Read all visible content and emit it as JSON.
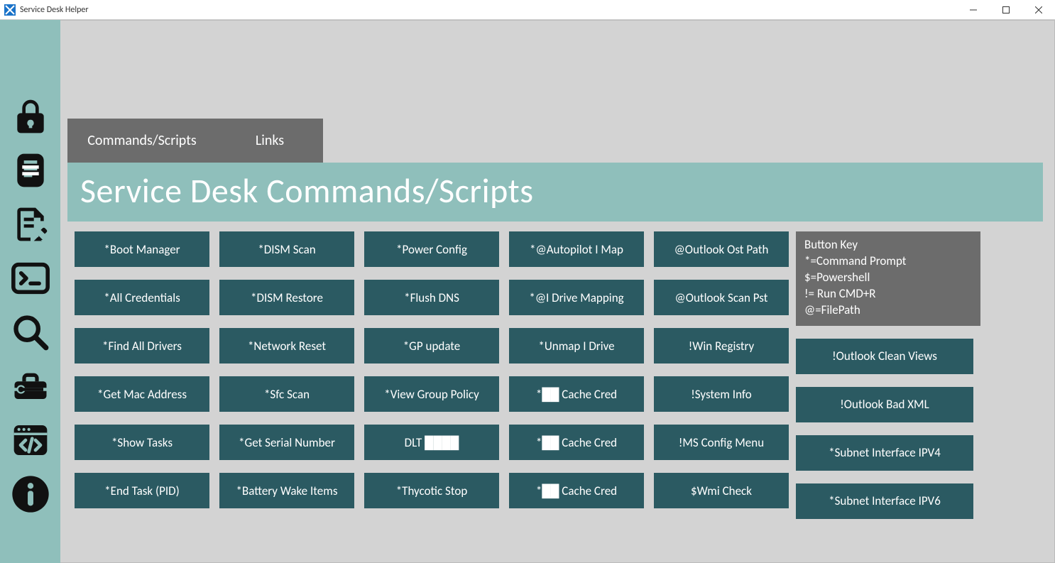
{
  "window": {
    "title": "Service Desk Helper"
  },
  "tabs": {
    "commands": "Commands/Scripts",
    "links": "Links"
  },
  "header": "Service Desk Commands/Scripts",
  "key": {
    "heading": "Button Key",
    "l1": "*=Command Prompt",
    "l2": "$=Powershell",
    "l3": "!= Run CMD+R",
    "l4": "@=FilePath"
  },
  "cols": {
    "c1": [
      "*Boot Manager",
      "*All Credentials",
      "*Find All Drivers",
      "*Get Mac Address",
      "*Show Tasks",
      "*End Task (PID)"
    ],
    "c2": [
      "*DISM Scan",
      "*DISM Restore",
      "*Network Reset",
      "*Sfc Scan",
      "*Get Serial Number",
      "*Battery Wake Items"
    ],
    "c3": [
      "*Power Config",
      "*Flush DNS",
      "*GP update",
      "*View Group Policy",
      "DLT ████",
      "*Thycotic Stop"
    ],
    "c4": [
      "*@Autopilot I Map",
      "*@I Drive Mapping",
      "*Unmap I Drive",
      "*██ Cache Cred",
      "*██ Cache Cred",
      "*██ Cache Cred"
    ],
    "c5": [
      "@Outlook Ost Path",
      "@Outlook Scan Pst",
      "!Win Registry",
      "!System Info",
      "!MS Config Menu",
      "$Wmi Check"
    ],
    "c6": [
      "!Outlook Clean Views",
      "!Outlook Bad XML",
      "*Subnet Interface IPV4",
      "*Subnet Interface IPV6"
    ]
  }
}
